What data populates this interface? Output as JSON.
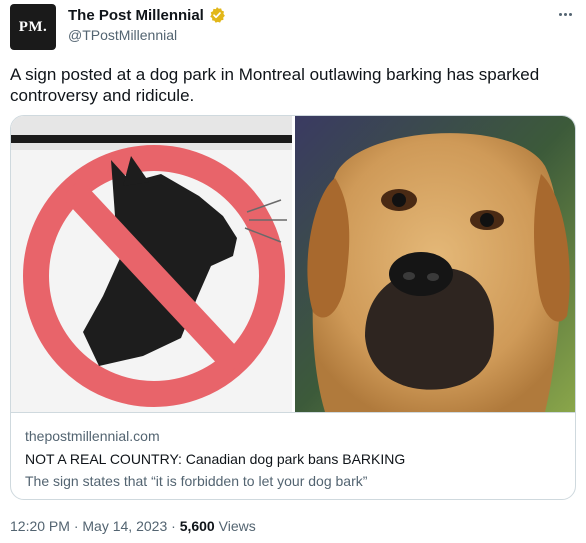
{
  "header": {
    "avatar_text": "PM.",
    "display_name": "The Post Millennial",
    "handle": "@TPostMillennial"
  },
  "tweet": {
    "text": "A sign posted at a dog park in Montreal outlawing barking has sparked controversy and ridicule."
  },
  "card": {
    "domain": "thepostmillennial.com",
    "title": "NOT A REAL COUNTRY: Canadian dog park bans BARKING",
    "description": "The sign states that “it is forbidden to let your dog bark”"
  },
  "footer": {
    "time": "12:20 PM",
    "separator": "·",
    "date": "May 14, 2023",
    "views_count": "5,600",
    "views_label": "Views"
  },
  "icons": {
    "verified": "verified-badge-icon",
    "more": "more-options-icon"
  },
  "colors": {
    "verified_gold": "#e2b719",
    "prohibition_red": "#e8646a",
    "text_primary": "#0f1419",
    "text_secondary": "#536471"
  }
}
